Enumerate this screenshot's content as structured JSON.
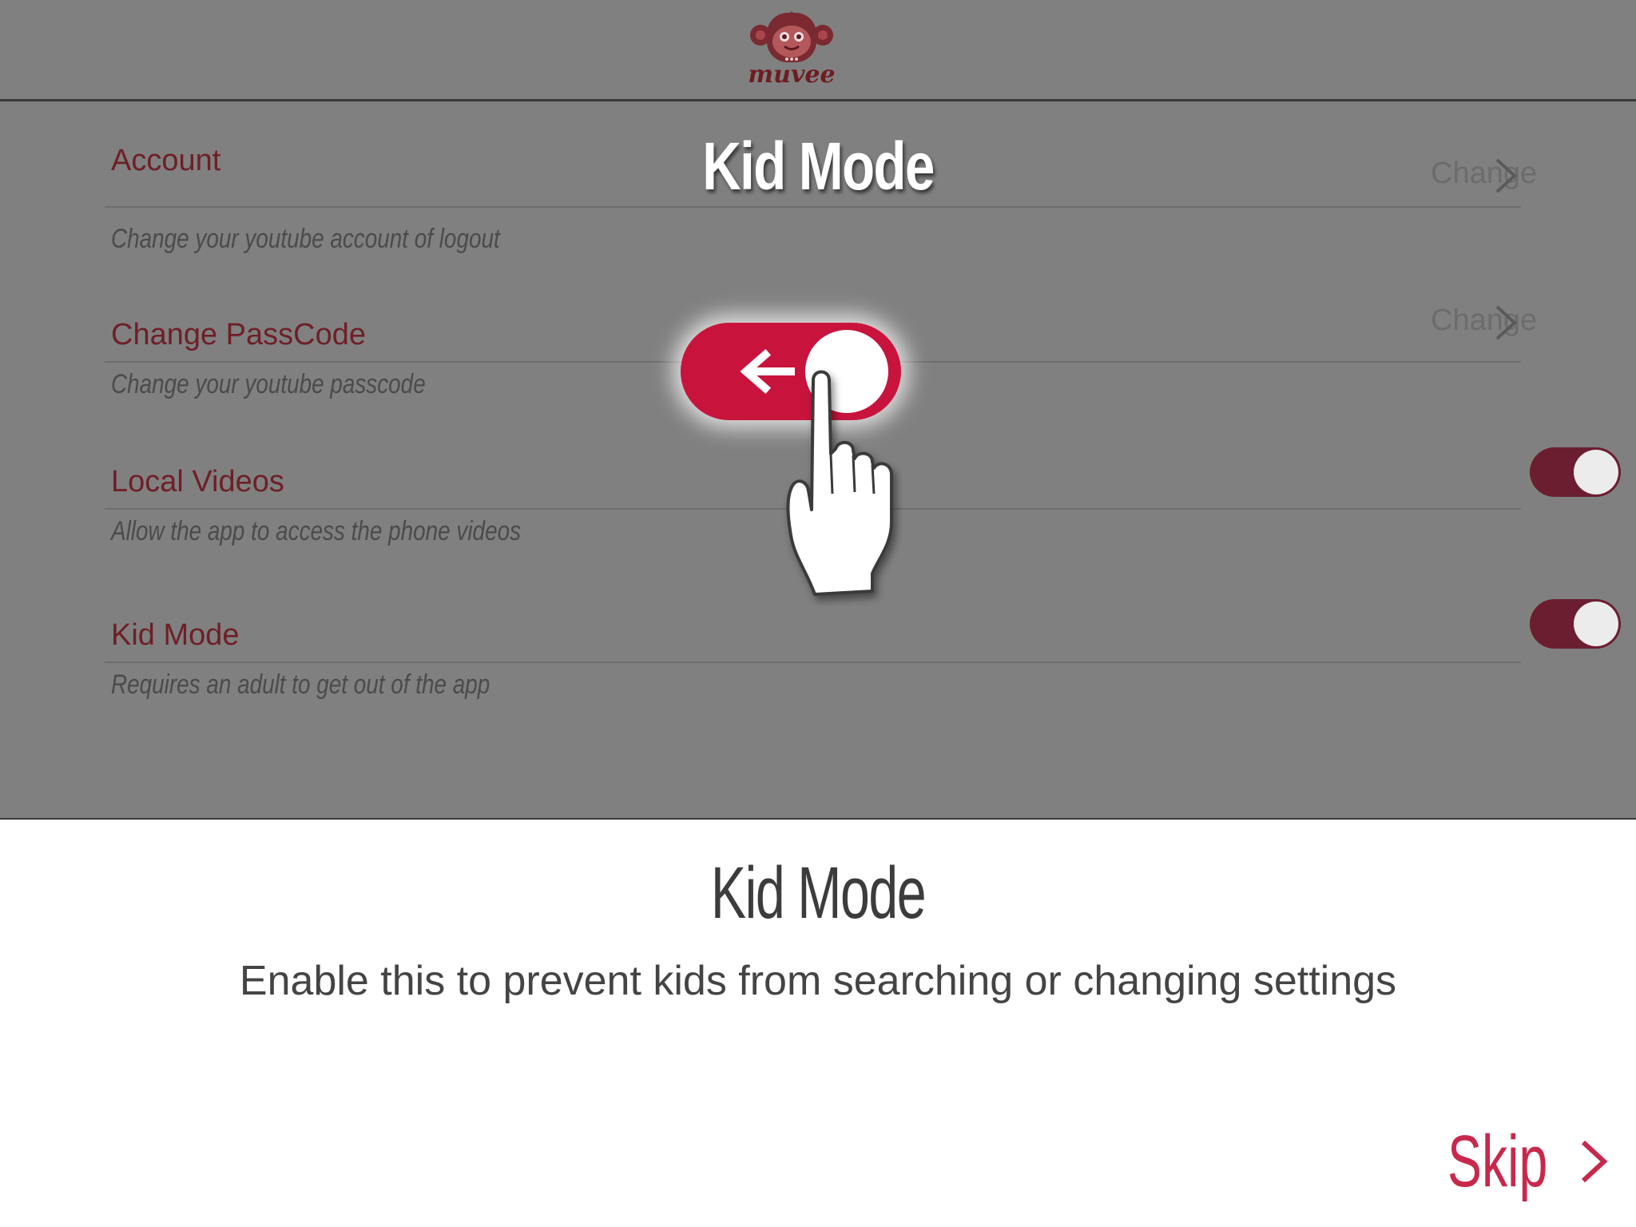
{
  "app": {
    "logo_text": "muvee"
  },
  "overlay": {
    "title": "Kid Mode"
  },
  "settings": {
    "rows": [
      {
        "title": "Account",
        "description": "Change your youtube account of logout",
        "action": "Change"
      },
      {
        "title": "Change PassCode",
        "description": "Change your youtube passcode",
        "action": "Change"
      },
      {
        "title": "Local Videos",
        "description": "Allow the app to access the phone videos",
        "toggle_on": true
      },
      {
        "title": "Kid Mode",
        "description": "Requires an adult to get out of the app",
        "toggle_on": true
      }
    ]
  },
  "tutorial": {
    "title": "Kid Mode",
    "description": "Enable this to prevent kids from searching or changing settings",
    "skip_label": "Skip"
  },
  "icons": {
    "logo": "monkey-mascot-icon",
    "chevron": "chevron-right-icon",
    "arrow": "arrow-left-icon",
    "hand": "pointing-hand-icon"
  },
  "colors": {
    "accent": "#c8143c",
    "toggle_on": "#6b1e2f",
    "row_title": "#6e1f27",
    "skip": "#c8284c",
    "overlay_bg": "#808080"
  }
}
